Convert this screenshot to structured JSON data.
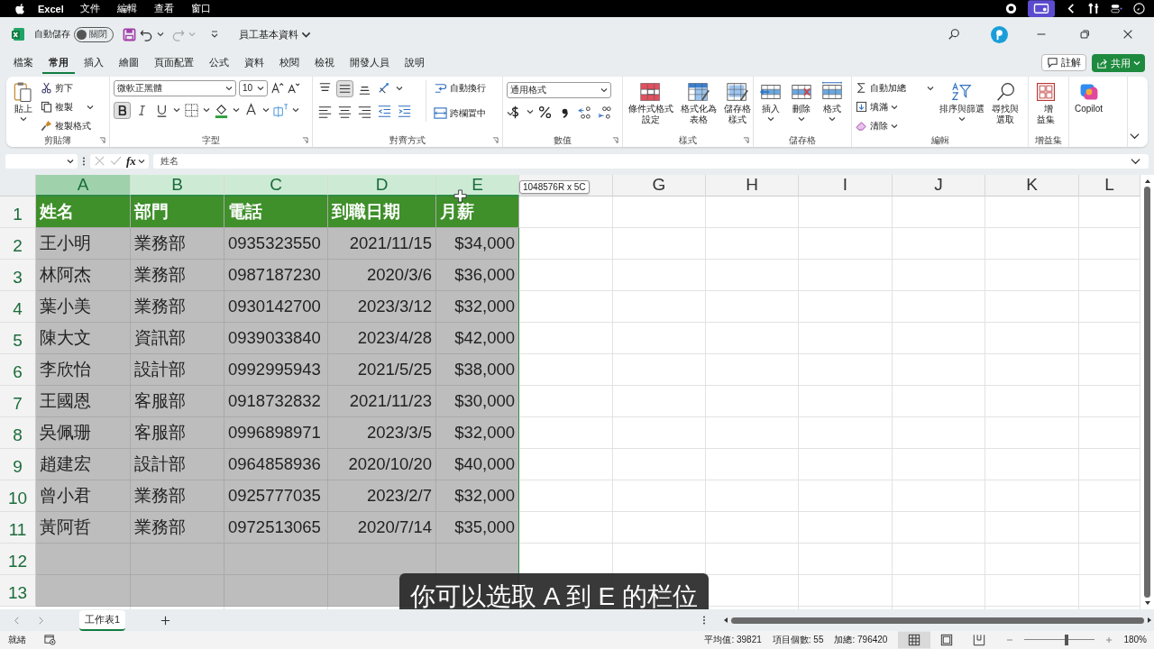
{
  "menu_bar": {
    "app": "Excel",
    "items": [
      "文件",
      "編輯",
      "查看",
      "窗口"
    ]
  },
  "title_bar": {
    "autosave_label": "自動儲存",
    "autosave": {
      "on": false,
      "label": "關閉"
    },
    "document_title": "員工基本資料"
  },
  "ribbon_tabs": [
    {
      "label": "檔案",
      "selected": false
    },
    {
      "label": "常用",
      "selected": true
    },
    {
      "label": "插入",
      "selected": false
    },
    {
      "label": "繪圖",
      "selected": false
    },
    {
      "label": "頁面配置",
      "selected": false
    },
    {
      "label": "公式",
      "selected": false
    },
    {
      "label": "資料",
      "selected": false
    },
    {
      "label": "校閱",
      "selected": false
    },
    {
      "label": "檢視",
      "selected": false
    },
    {
      "label": "開發人員",
      "selected": false
    },
    {
      "label": "說明",
      "selected": false
    }
  ],
  "comments_button": "註解",
  "share_button": "共用",
  "ribbon": {
    "clipboard": {
      "paste": "貼上",
      "cut": "剪下",
      "copy": "複製",
      "format_painter": "複製格式",
      "label": "剪貼簿"
    },
    "font": {
      "name": "微軟正黑體",
      "size": "10",
      "bold": true,
      "label": "字型"
    },
    "alignment": {
      "align_middle": true,
      "wrap": "自動換行",
      "merge": "跨欄置中",
      "label": "對齊方式"
    },
    "number": {
      "format": "通用格式",
      "label": "數值"
    },
    "styles": {
      "items": [
        "條件式格式設定",
        "格式化為表格",
        "儲存格樣式"
      ],
      "label": "樣式"
    },
    "cells": {
      "items": [
        "插入",
        "刪除",
        "格式"
      ],
      "label": "儲存格"
    },
    "editing": {
      "autosum": "自動加總",
      "fill": "填滿",
      "clear": "清除",
      "sort": "排序與篩選",
      "find": "尋找與選取",
      "label": "編輯"
    },
    "addins": {
      "button": "增益集",
      "label": "增益集"
    },
    "copilot": "Copilot"
  },
  "formula_bar": {
    "function_label": "fx",
    "formula": "姓名"
  },
  "sheet": {
    "columns": [
      {
        "label": "A",
        "selected": true,
        "active": true
      },
      {
        "label": "B",
        "selected": true,
        "active": false
      },
      {
        "label": "C",
        "selected": true,
        "active": false
      },
      {
        "label": "D",
        "selected": true,
        "active": false
      },
      {
        "label": "E",
        "selected": true,
        "active": false
      },
      {
        "selected": false,
        "active": false
      },
      {
        "label": "G",
        "selected": false,
        "active": false
      },
      {
        "label": "H",
        "selected": false,
        "active": false
      },
      {
        "label": "I",
        "selected": false,
        "active": false
      },
      {
        "label": "J",
        "selected": false,
        "active": false
      },
      {
        "label": "K",
        "selected": false,
        "active": false
      },
      {
        "label": "L",
        "selected": false,
        "active": false
      }
    ],
    "row_numbers": [
      "1",
      "2",
      "3",
      "4",
      "5",
      "6",
      "7",
      "8",
      "9",
      "10",
      "11",
      "12",
      "13"
    ],
    "header_cells": [
      {
        "label": "姓名",
        "kind": "text"
      },
      {
        "label": "部門",
        "kind": "text"
      },
      {
        "label": "電話",
        "kind": "text"
      },
      {
        "label": "到職日期",
        "kind": "number"
      },
      {
        "label": "月薪",
        "kind": "number"
      }
    ],
    "rows": [
      [
        "王小明",
        "業務部",
        "0935323550",
        "2021/11/15",
        "$34,000"
      ],
      [
        "林阿杰",
        "業務部",
        "0987187230",
        "2020/3/6",
        "$36,000"
      ],
      [
        "葉小美",
        "業務部",
        "0930142700",
        "2023/3/12",
        "$32,000"
      ],
      [
        "陳大文",
        "資訊部",
        "0939033840",
        "2023/4/28",
        "$42,000"
      ],
      [
        "李欣怡",
        "設計部",
        "0992995943",
        "2021/5/25",
        "$38,000"
      ],
      [
        "王國恩",
        "客服部",
        "0918732832",
        "2021/11/23",
        "$30,000"
      ],
      [
        "吳佩珊",
        "客服部",
        "0996898971",
        "2023/3/5",
        "$32,000"
      ],
      [
        "趙建宏",
        "設計部",
        "0964858936",
        "2020/10/20",
        "$40,000"
      ],
      [
        "曾小君",
        "業務部",
        "0925777035",
        "2023/2/7",
        "$32,000"
      ],
      [
        "黃阿哲",
        "業務部",
        "0972513065",
        "2020/7/14",
        "$35,000"
      ]
    ],
    "tooltip": "1048576R x 5C"
  },
  "sheet_tabs": [
    {
      "label": "工作表1",
      "selected": true
    }
  ],
  "status_bar": {
    "status": "就緒",
    "average": "平均值: 39821",
    "count": "項目個數: 55",
    "sum": "加總: 796420",
    "views": [
      {
        "selected": true
      },
      {
        "selected": false
      },
      {
        "selected": false
      }
    ],
    "zoom": {
      "level": 0.6
    },
    "zoom_label": "180%"
  },
  "caption": "你可以选取 A 到 E 的栏位"
}
